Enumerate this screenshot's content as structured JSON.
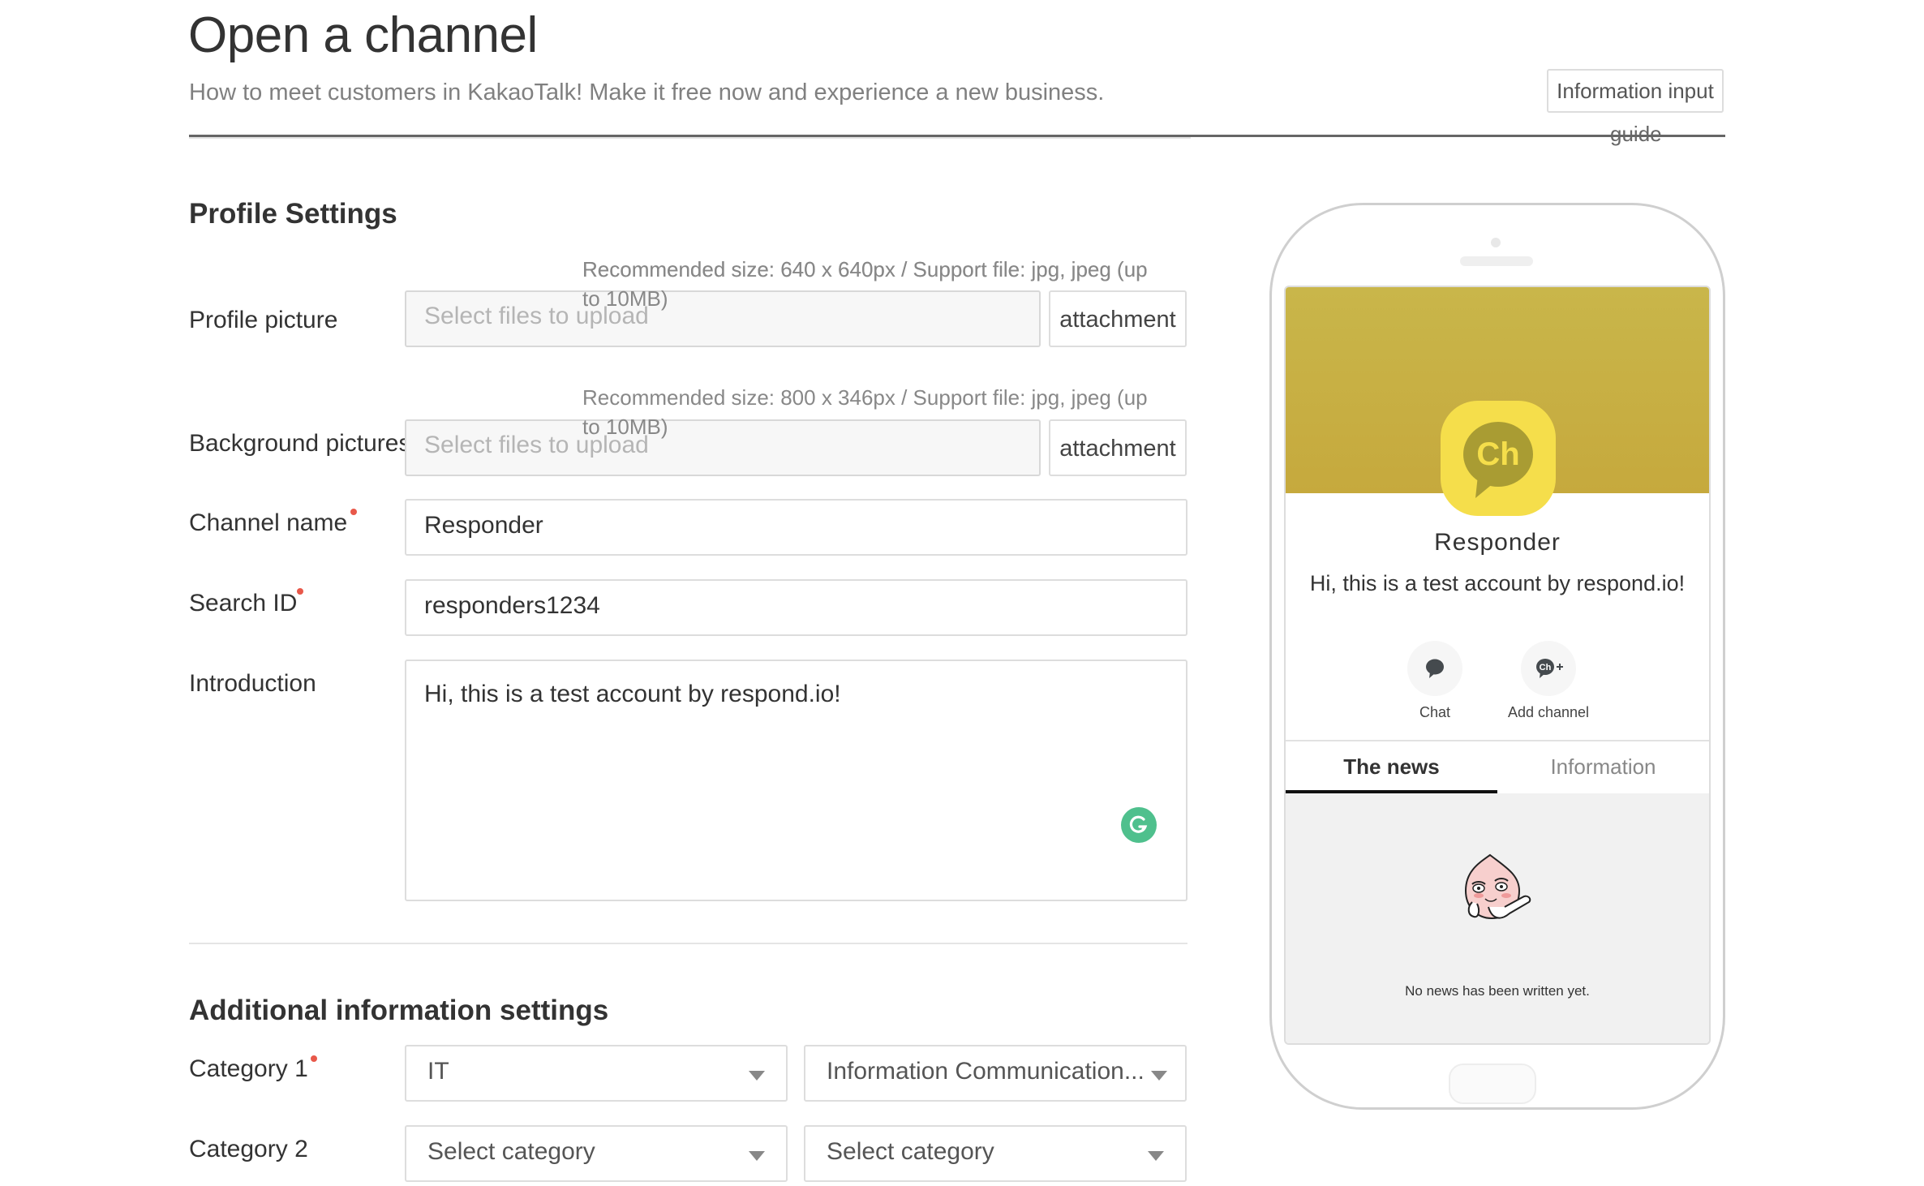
{
  "header": {
    "title": "Open a channel",
    "subtitle": "How to meet customers in KakaoTalk! Make it free now and experience a new business.",
    "guide_button_line1": "Information input",
    "guide_button_line2": "guide"
  },
  "profile_settings": {
    "heading": "Profile Settings",
    "profile_picture": {
      "label": "Profile picture",
      "hint": "Recommended size: 640 x 640px / Support file: jpg, jpeg (up to 10MB)",
      "placeholder": "Select files to upload",
      "button": "attachment"
    },
    "background_pictures": {
      "label": "Background pictures",
      "hint": "Recommended size: 800 x 346px / Support file: jpg, jpeg (up to 10MB)",
      "placeholder": "Select files to upload",
      "button": "attachment"
    },
    "channel_name": {
      "label": "Channel name",
      "required": true,
      "value": "Responder"
    },
    "search_id": {
      "label": "Search ID",
      "required": true,
      "value": "responders1234"
    },
    "introduction": {
      "label": "Introduction",
      "value": "Hi, this is a test account by respond.io!"
    }
  },
  "additional_settings": {
    "heading": "Additional information settings",
    "category1": {
      "label": "Category 1",
      "required": true,
      "primary": "IT",
      "secondary": "Information Communication..."
    },
    "category2": {
      "label": "Category 2",
      "primary": "Select category",
      "secondary": "Select category"
    }
  },
  "preview": {
    "avatar_text": "Ch",
    "name": "Responder",
    "intro": "Hi, this is a test account by respond.io!",
    "actions": [
      {
        "label": "Chat",
        "icon": "chat-bubble-icon"
      },
      {
        "label": "Add channel",
        "icon": "add-channel-icon"
      }
    ],
    "tabs": [
      {
        "label": "The news",
        "active": true
      },
      {
        "label": "Information",
        "active": false
      }
    ],
    "empty_message": "No news has been written yet.",
    "colors": {
      "banner": "#c8b246",
      "avatar_bg": "#f5de4b",
      "required_dot": "#e8584a",
      "grammarly": "#4fc08d"
    }
  }
}
